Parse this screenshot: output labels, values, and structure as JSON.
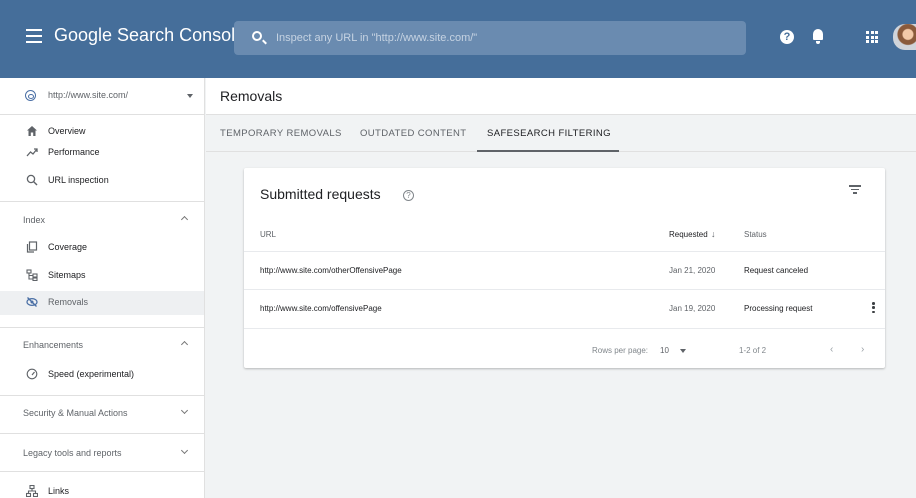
{
  "header": {
    "app_name": "Google Search Console",
    "search_placeholder": "Inspect any URL in \"http://www.site.com/\"",
    "help_glyph": "?"
  },
  "sidebar": {
    "property": "http://www.site.com/",
    "top_items": [
      {
        "label": "Overview",
        "icon": "home-icon"
      },
      {
        "label": "Performance",
        "icon": "trending-up-icon"
      },
      {
        "label": "URL inspection",
        "icon": "search-icon"
      }
    ],
    "index": {
      "label": "Index",
      "items": [
        {
          "label": "Coverage",
          "icon": "coverage-icon"
        },
        {
          "label": "Sitemaps",
          "icon": "sitemap-icon"
        },
        {
          "label": "Removals",
          "icon": "removals-icon",
          "active": true
        }
      ]
    },
    "enhancements": {
      "label": "Enhancements",
      "items": [
        {
          "label": "Speed (experimental)",
          "icon": "speed-icon"
        }
      ]
    },
    "security": {
      "label": "Security & Manual Actions"
    },
    "legacy": {
      "label": "Legacy tools and reports"
    },
    "links": {
      "label": "Links",
      "icon": "links-icon"
    }
  },
  "page": {
    "title": "Removals",
    "tabs": [
      {
        "label": "TEMPORARY REMOVALS",
        "active": false
      },
      {
        "label": "OUTDATED CONTENT",
        "active": false
      },
      {
        "label": "SAFESEARCH FILTERING",
        "active": true
      }
    ]
  },
  "card": {
    "title": "Submitted requests",
    "help_glyph": "?",
    "columns": {
      "url": "URL",
      "requested": "Requested",
      "status": "Status"
    },
    "sort_glyph": "↓",
    "rows": [
      {
        "url": "http://www.site.com/otherOffensivePage",
        "requested": "Jan 21, 2020",
        "status": "Request canceled"
      },
      {
        "url": "http://www.site.com/offensivePage",
        "requested": "Jan 19, 2020",
        "status": "Processing request"
      }
    ],
    "pagination": {
      "rows_per_page_label": "Rows per page:",
      "rows_per_page_value": "10",
      "range": "1-2 of 2",
      "prev_glyph": "‹",
      "next_glyph": "›"
    }
  },
  "colors": {
    "header_bg": "#456e9a",
    "search_bg": "#6a8bb0",
    "page_bg": "#f1f3f4",
    "active_nav_bg": "#eef0f2"
  }
}
